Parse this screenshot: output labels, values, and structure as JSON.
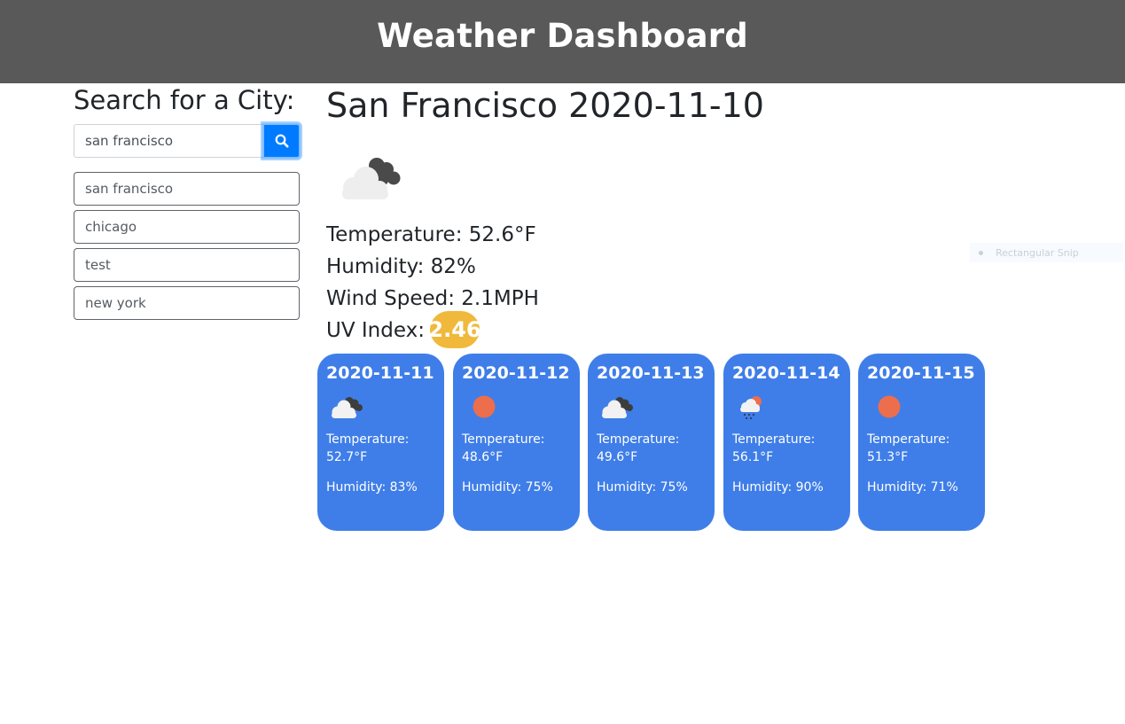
{
  "header": {
    "title": "Weather Dashboard"
  },
  "search": {
    "title": "Search for a City:",
    "input_value": "san francisco",
    "button_icon": "search-icon",
    "history": [
      "san francisco",
      "chicago",
      "test",
      "new york"
    ]
  },
  "current": {
    "title": "San Francisco 2020-11-10",
    "icon": "cloudy-icon",
    "temperature": "Temperature: 52.6°F",
    "humidity": "Humidity: 82%",
    "wind": "Wind Speed: 2.1MPH",
    "uv_label": "UV Index:",
    "uv_value": "2.46"
  },
  "forecast": [
    {
      "date": "2020-11-11",
      "icon": "cloudy-icon",
      "temp_label": "Temperature:",
      "temp_value": "52.7°F",
      "humidity": "Humidity: 83%"
    },
    {
      "date": "2020-11-12",
      "icon": "sun-icon",
      "temp_label": "Temperature:",
      "temp_value": "48.6°F",
      "humidity": "Humidity: 75%"
    },
    {
      "date": "2020-11-13",
      "icon": "cloudy-icon",
      "temp_label": "Temperature:",
      "temp_value": "49.6°F",
      "humidity": "Humidity: 75%"
    },
    {
      "date": "2020-11-14",
      "icon": "rain-icon",
      "temp_label": "Temperature:",
      "temp_value": "56.1°F",
      "humidity": "Humidity: 90%"
    },
    {
      "date": "2020-11-15",
      "icon": "sun-icon",
      "temp_label": "Temperature:",
      "temp_value": "51.3°F",
      "humidity": "Humidity: 71%"
    }
  ],
  "overlay": {
    "snip_label": "Rectangular Snip"
  },
  "colors": {
    "header_bg": "#595959",
    "card_bg": "#3f7ee8",
    "uv_badge": "#f0b93b",
    "search_button": "#007bff",
    "sun": "#ec6e4c"
  }
}
